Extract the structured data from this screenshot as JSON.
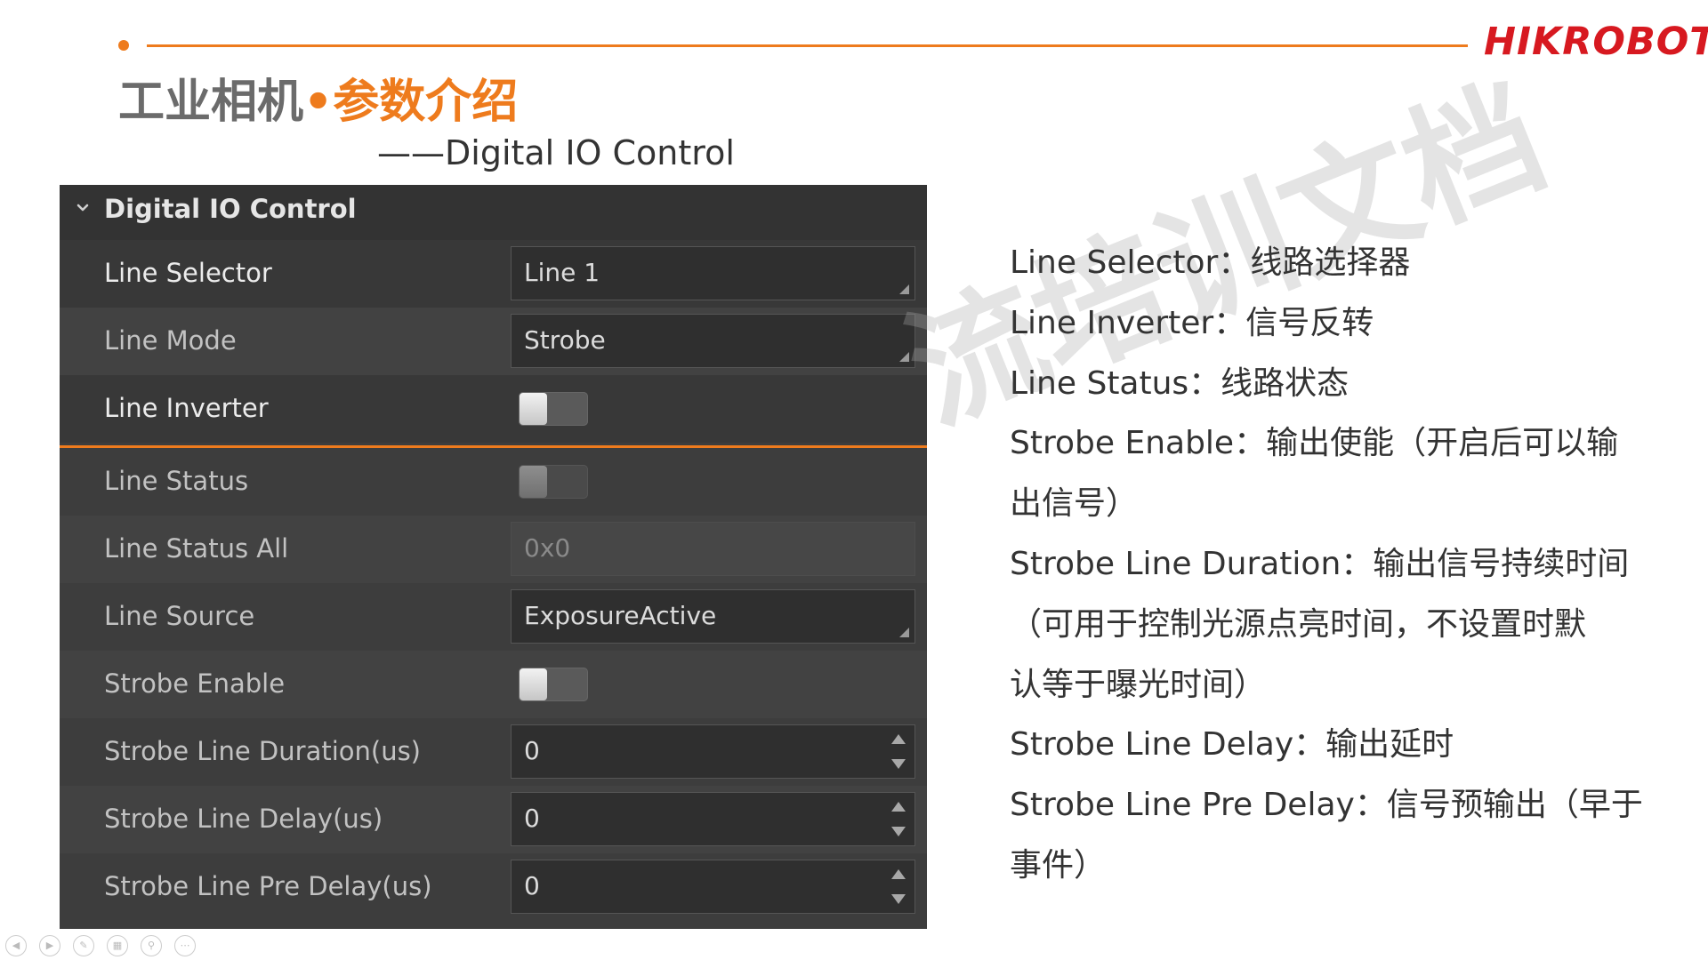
{
  "header": {
    "brand": "HIKROBOT",
    "title_main": "工业相机",
    "title_dot": "•",
    "title_sub": "参数介绍",
    "subtitle": "——Digital IO Control"
  },
  "watermark": "流培训文档",
  "panel": {
    "title": "Digital IO Control",
    "rows": [
      {
        "label": "Line Selector",
        "type": "dropdown",
        "value": "Line 1"
      },
      {
        "label": "Line Mode",
        "type": "dropdown",
        "value": "Strobe"
      },
      {
        "label": "Line Inverter",
        "type": "toggle",
        "value": "off"
      },
      {
        "label": "Line Status",
        "type": "toggle",
        "value": "off",
        "disabled": true
      },
      {
        "label": "Line Status All",
        "type": "text",
        "value": "0x0",
        "disabled": true
      },
      {
        "label": "Line Source",
        "type": "dropdown",
        "value": "ExposureActive"
      },
      {
        "label": "Strobe Enable",
        "type": "toggle",
        "value": "off"
      },
      {
        "label": "Strobe Line Duration(us)",
        "type": "spin",
        "value": "0"
      },
      {
        "label": "Strobe Line Delay(us)",
        "type": "spin",
        "value": "0"
      },
      {
        "label": "Strobe Line Pre Delay(us)",
        "type": "spin",
        "value": "0"
      }
    ]
  },
  "description": [
    "Line Selector：线路选择器",
    "Line Inverter：信号反转",
    "Line Status：线路状态",
    "Strobe Enable：输出使能（开启后可以输",
    "出信号）",
    "Strobe Line Duration：输出信号持续时间",
    "（可用于控制光源点亮时间，不设置时默",
    "认等于曝光时间）",
    "Strobe Line Delay：输出延时",
    "Strobe Line Pre Delay：信号预输出（早于",
    "事件）"
  ],
  "nav_icons": [
    "prev-slide-icon",
    "next-slide-icon",
    "pen-icon",
    "slides-grid-icon",
    "zoom-icon",
    "more-icon"
  ],
  "colors": {
    "accent": "#ee7b1d",
    "brand": "#d71920",
    "panel_bg": "#3d3d3d",
    "panel_header": "#333333"
  }
}
